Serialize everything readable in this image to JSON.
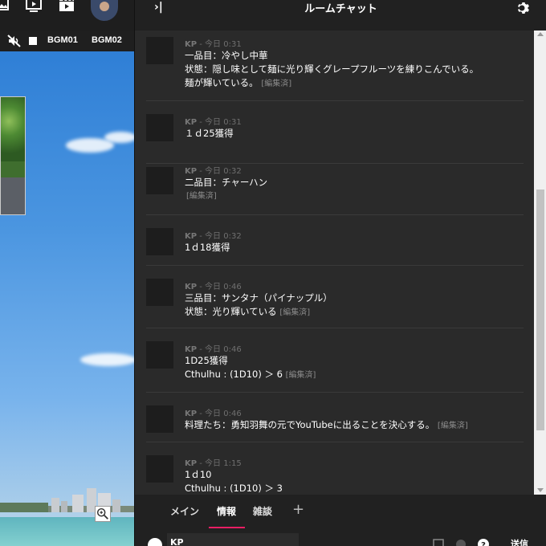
{
  "toolbar": {
    "bgm_buttons": [
      "BGM01",
      "BGM02"
    ]
  },
  "panel": {
    "title": "ルームチャット",
    "collapse_glyph": "›|"
  },
  "messages": [
    {
      "name": "KP",
      "time": "- 今日 0:31",
      "lines": [
        "一品目：冷やし中華",
        "状態：隠し味として麺に光り輝くグレープフルーツを練りこんでいる。",
        "麺が輝いている。"
      ],
      "edited": "[編集済]"
    },
    {
      "name": "KP",
      "time": "- 今日 0:31",
      "lines": [
        "１ｄ25獲得"
      ],
      "edited": ""
    },
    {
      "name": "KP",
      "time": "- 今日 0:32",
      "lines": [
        "二品目：チャーハン"
      ],
      "edited": "[編集済]"
    },
    {
      "name": "KP",
      "time": "- 今日 0:32",
      "lines": [
        "1ｄ18獲得"
      ],
      "edited": ""
    },
    {
      "name": "KP",
      "time": "- 今日 0:46",
      "lines": [
        "三品目：サンタナ（パイナップル）",
        "状態：光り輝いている"
      ],
      "edited": "[編集済]"
    },
    {
      "name": "KP",
      "time": "- 今日 0:46",
      "lines": [
        "1D25獲得",
        "Cthulhu : (1D10) ＞ 6"
      ],
      "edited": "[編集済]"
    },
    {
      "name": "KP",
      "time": "- 今日 0:46",
      "lines": [
        "料理たち：勇知羽舞の元でYouTubeに出ることを決心する。"
      ],
      "edited": "[編集済]"
    },
    {
      "name": "KP",
      "time": "- 今日 1:15",
      "lines": [
        "1ｄ10",
        "Cthulhu : (1D10) ＞ 3"
      ],
      "edited": ""
    }
  ],
  "tabs": [
    {
      "label": "メイン",
      "active": false
    },
    {
      "label": "情報",
      "active": true
    },
    {
      "label": "雑談",
      "active": false
    }
  ],
  "add_tab_glyph": "+",
  "input": {
    "name": "KP",
    "send_label": "送信"
  },
  "colors": {
    "accent": "#e91e63",
    "panel_bg": "#212121",
    "message_bg": "#2a2a2a"
  },
  "icons": [
    "gallery-icon",
    "screen-icon",
    "clapper-icon",
    "user-avatar",
    "mute-icon",
    "stop-icon",
    "settings-icon",
    "zoom-icon"
  ]
}
